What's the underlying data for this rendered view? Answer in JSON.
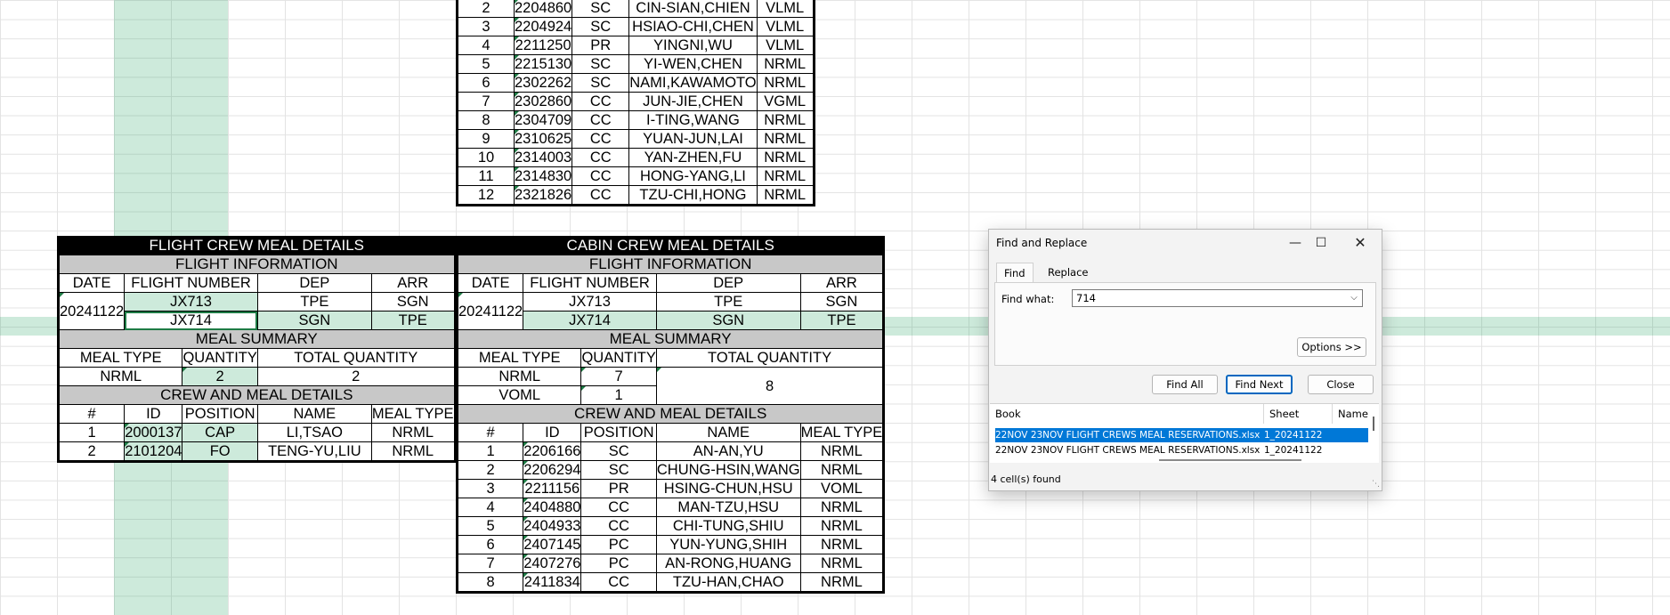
{
  "flight_crew": {
    "title": "FLIGHT CREW MEAL DETAILS",
    "flight_info_label": "FLIGHT INFORMATION",
    "headers": [
      "DATE",
      "FLIGHT NUMBER",
      "DEP",
      "ARR"
    ],
    "date": "20241122",
    "flights": [
      {
        "number": "JX713",
        "dep": "TPE",
        "arr": "SGN"
      },
      {
        "number": "JX714",
        "dep": "SGN",
        "arr": "TPE"
      }
    ],
    "meal_summary_label": "MEAL SUMMARY",
    "summary_headers": [
      "MEAL TYPE",
      "QUANTITY",
      "TOTAL QUANTITY"
    ],
    "summary": {
      "type": "NRML",
      "qty": "2",
      "total": "2"
    },
    "crew_label": "CREW AND MEAL DETAILS",
    "crew_headers": [
      "#",
      "ID",
      "POSITION",
      "NAME",
      "MEAL TYPE"
    ],
    "crew": [
      {
        "no": "1",
        "id": "2000137",
        "pos": "CAP",
        "name": "LI,TSAO",
        "meal": "NRML"
      },
      {
        "no": "2",
        "id": "2101204",
        "pos": "FO",
        "name": "TENG-YU,LIU",
        "meal": "NRML"
      }
    ]
  },
  "top_table": {
    "rows": [
      {
        "no": "2",
        "id": "2204860",
        "pos": "SC",
        "name": "CIN-SIAN,CHIEN",
        "meal": "VLML"
      },
      {
        "no": "3",
        "id": "2204924",
        "pos": "SC",
        "name": "HSIAO-CHI,CHEN",
        "meal": "VLML"
      },
      {
        "no": "4",
        "id": "2211250",
        "pos": "PR",
        "name": "YINGNI,WU",
        "meal": "VLML"
      },
      {
        "no": "5",
        "id": "2215130",
        "pos": "SC",
        "name": "YI-WEN,CHEN",
        "meal": "NRML"
      },
      {
        "no": "6",
        "id": "2302262",
        "pos": "SC",
        "name": "NAMI,KAWAMOTO",
        "meal": "NRML"
      },
      {
        "no": "7",
        "id": "2302860",
        "pos": "CC",
        "name": "JUN-JIE,CHEN",
        "meal": "VGML"
      },
      {
        "no": "8",
        "id": "2304709",
        "pos": "CC",
        "name": "I-TING,WANG",
        "meal": "NRML"
      },
      {
        "no": "9",
        "id": "2310625",
        "pos": "CC",
        "name": "YUAN-JUN,LAI",
        "meal": "NRML"
      },
      {
        "no": "10",
        "id": "2314003",
        "pos": "CC",
        "name": "YAN-ZHEN,FU",
        "meal": "NRML"
      },
      {
        "no": "11",
        "id": "2314830",
        "pos": "CC",
        "name": "HONG-YANG,LI",
        "meal": "NRML"
      },
      {
        "no": "12",
        "id": "2321826",
        "pos": "CC",
        "name": "TZU-CHI,HONG",
        "meal": "NRML"
      }
    ]
  },
  "cabin_crew": {
    "title": "CABIN CREW MEAL DETAILS",
    "flight_info_label": "FLIGHT INFORMATION",
    "headers": [
      "DATE",
      "FLIGHT NUMBER",
      "DEP",
      "ARR"
    ],
    "date": "20241122",
    "flights": [
      {
        "number": "JX713",
        "dep": "TPE",
        "arr": "SGN"
      },
      {
        "number": "JX714",
        "dep": "SGN",
        "arr": "TPE"
      }
    ],
    "meal_summary_label": "MEAL SUMMARY",
    "summary_headers": [
      "MEAL TYPE",
      "QUANTITY",
      "TOTAL QUANTITY"
    ],
    "summary": [
      {
        "type": "NRML",
        "qty": "7"
      },
      {
        "type": "VOML",
        "qty": "1"
      }
    ],
    "summary_total": "8",
    "crew_label": "CREW AND MEAL DETAILS",
    "crew_headers": [
      "#",
      "ID",
      "POSITION",
      "NAME",
      "MEAL TYPE"
    ],
    "crew": [
      {
        "no": "1",
        "id": "2206166",
        "pos": "SC",
        "name": "AN-AN,YU",
        "meal": "NRML"
      },
      {
        "no": "2",
        "id": "2206294",
        "pos": "SC",
        "name": "CHUNG-HSIN,WANG",
        "meal": "NRML"
      },
      {
        "no": "3",
        "id": "2211156",
        "pos": "PR",
        "name": "HSING-CHUN,HSU",
        "meal": "VOML"
      },
      {
        "no": "4",
        "id": "2404880",
        "pos": "CC",
        "name": "MAN-TZU,HSU",
        "meal": "NRML"
      },
      {
        "no": "5",
        "id": "2404933",
        "pos": "CC",
        "name": "CHI-TUNG,SHIU",
        "meal": "NRML"
      },
      {
        "no": "6",
        "id": "2407145",
        "pos": "PC",
        "name": "YUN-YUNG,SHIH",
        "meal": "NRML"
      },
      {
        "no": "7",
        "id": "2407276",
        "pos": "PC",
        "name": "AN-RONG,HUANG",
        "meal": "NRML"
      },
      {
        "no": "8",
        "id": "2411834",
        "pos": "CC",
        "name": "TZU-HAN,CHAO",
        "meal": "NRML"
      }
    ]
  },
  "dialog": {
    "title": "Find and Replace",
    "minimize_icon": "minimize-icon",
    "maximize_icon": "maximize-icon",
    "close_icon": "close-icon",
    "tab_find": "Find",
    "tab_replace": "Replace",
    "find_what_label": "Find what:",
    "find_what_value": "714",
    "options_button": "Options >>",
    "find_all_button": "Find All",
    "find_next_button": "Find Next",
    "close_button": "Close",
    "results_headers": [
      "Book",
      "Sheet",
      "Name"
    ],
    "results": [
      {
        "book": "22NOV 23NOV FLIGHT CREWS MEAL RESERVATIONS.xlsx",
        "sheet": "1_20241122",
        "name": ""
      },
      {
        "book": "22NOV 23NOV FLIGHT CREWS MEAL RESERVATIONS.xlsx",
        "sheet": "1_20241122",
        "name": ""
      }
    ],
    "status": "4 cell(s) found",
    "accent_color": "#0078d7"
  }
}
